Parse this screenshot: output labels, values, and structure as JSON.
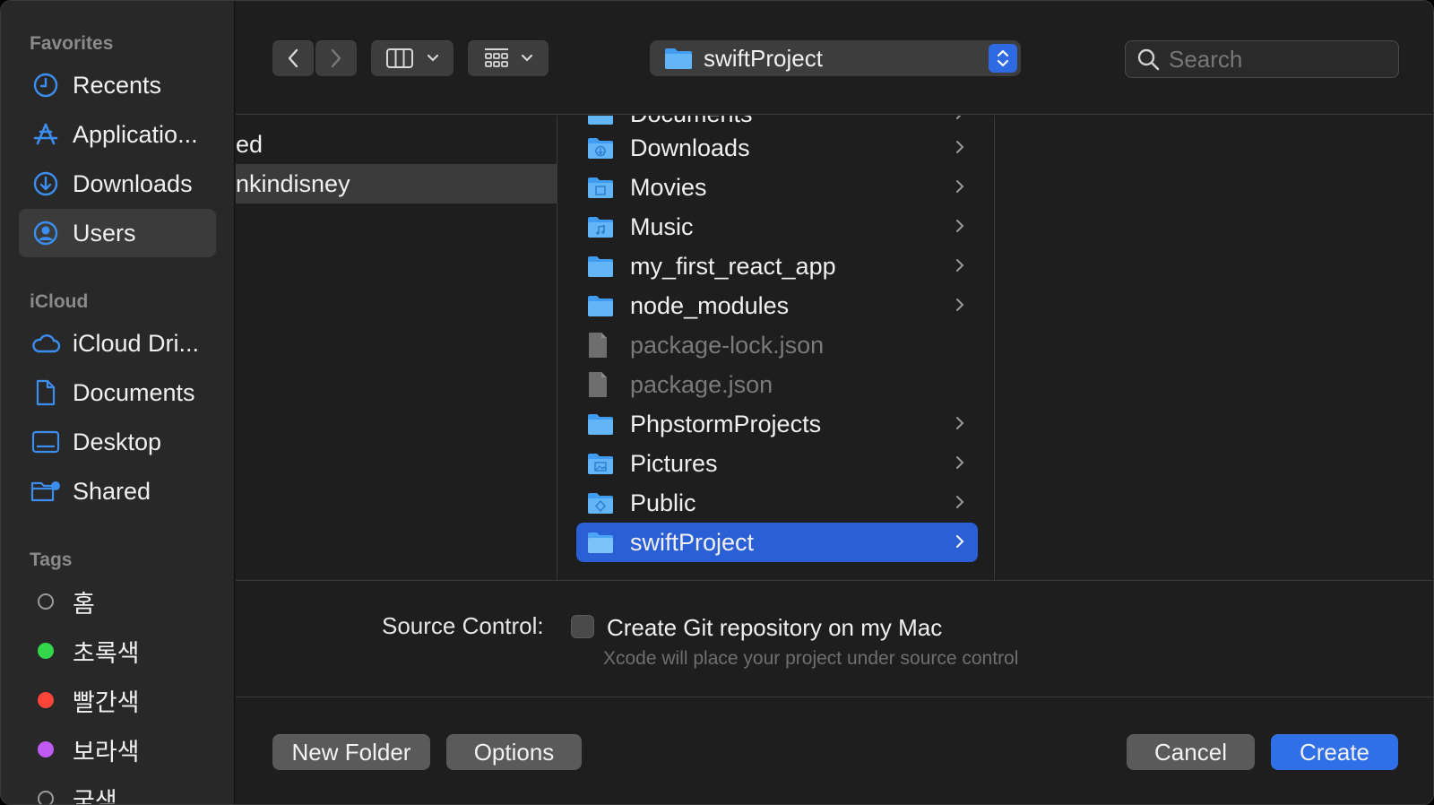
{
  "sidebar": {
    "favorites_heading": "Favorites",
    "favorites": [
      {
        "label": "Recents",
        "icon": "clock-icon"
      },
      {
        "label": "Applicatio...",
        "icon": "applications-icon"
      },
      {
        "label": "Downloads",
        "icon": "download-icon"
      },
      {
        "label": "Users",
        "icon": "user-circle-icon"
      }
    ],
    "icloud_heading": "iCloud",
    "icloud": [
      {
        "label": "iCloud Dri...",
        "icon": "cloud-icon"
      },
      {
        "label": "Documents",
        "icon": "document-icon"
      },
      {
        "label": "Desktop",
        "icon": "desktop-icon"
      },
      {
        "label": "Shared",
        "icon": "shared-folder-icon"
      }
    ],
    "tags_heading": "Tags",
    "tags": [
      {
        "label": "홈",
        "color": "none"
      },
      {
        "label": "초록색",
        "color": "#32d74b"
      },
      {
        "label": "빨간색",
        "color": "#ff453a"
      },
      {
        "label": "보라색",
        "color": "#bf5af2"
      },
      {
        "label": "굼색",
        "color": "none"
      }
    ],
    "selected": "Users"
  },
  "toolbar": {
    "location": "swiftProject",
    "search_placeholder": "Search"
  },
  "browser": {
    "column1": [
      {
        "label": "ed",
        "selected": false
      },
      {
        "label": "nkindisney",
        "selected": true
      }
    ],
    "column2": [
      {
        "label": "Documents",
        "type": "folder",
        "icon": "documents-folder-icon"
      },
      {
        "label": "Downloads",
        "type": "folder",
        "icon": "downloads-folder-icon"
      },
      {
        "label": "Movies",
        "type": "folder",
        "icon": "movies-folder-icon"
      },
      {
        "label": "Music",
        "type": "folder",
        "icon": "music-folder-icon"
      },
      {
        "label": "my_first_react_app",
        "type": "folder",
        "icon": "folder-icon"
      },
      {
        "label": "node_modules",
        "type": "folder",
        "icon": "folder-icon"
      },
      {
        "label": "package-lock.json",
        "type": "file",
        "icon": "file-icon"
      },
      {
        "label": "package.json",
        "type": "file",
        "icon": "file-icon"
      },
      {
        "label": "PhpstormProjects",
        "type": "folder",
        "icon": "folder-icon"
      },
      {
        "label": "Pictures",
        "type": "folder",
        "icon": "pictures-folder-icon"
      },
      {
        "label": "Public",
        "type": "folder",
        "icon": "public-folder-icon"
      },
      {
        "label": "swiftProject",
        "type": "folder",
        "icon": "folder-icon",
        "selected": true
      }
    ]
  },
  "source_control": {
    "label": "Source Control:",
    "checkbox_label": "Create Git repository on my Mac",
    "checked": false,
    "hint": "Xcode will place your project under source control"
  },
  "buttons": {
    "new_folder": "New Folder",
    "options": "Options",
    "cancel": "Cancel",
    "create": "Create"
  },
  "colors": {
    "accent": "#2f6fe8",
    "selection": "#2a5fd6"
  }
}
